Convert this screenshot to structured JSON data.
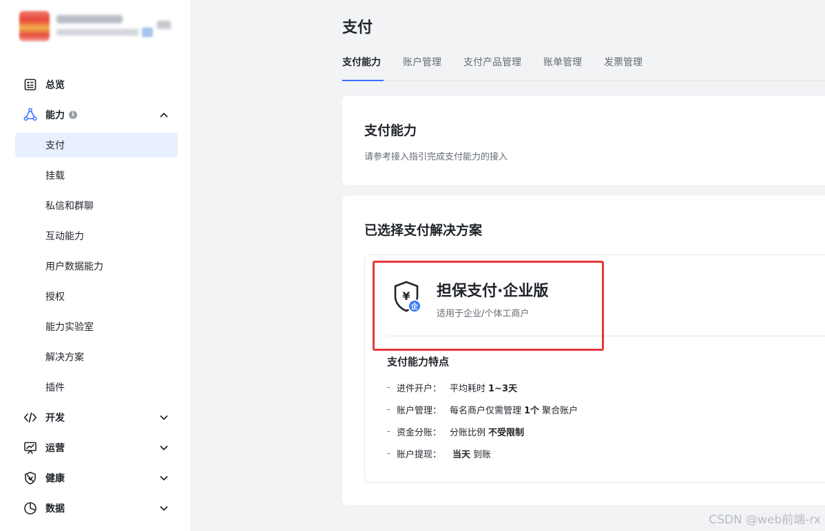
{
  "sidebar": {
    "items": [
      {
        "label": "总览",
        "icon": "dashboard-icon"
      },
      {
        "label": "能力",
        "icon": "capability-icon",
        "info": "i",
        "expanded": true,
        "children": [
          "支付",
          "挂载",
          "私信和群聊",
          "互动能力",
          "用户数据能力",
          "授权",
          "能力实验室",
          "解决方案",
          "插件"
        ],
        "active_child": "支付"
      },
      {
        "label": "开发",
        "icon": "code-icon"
      },
      {
        "label": "运营",
        "icon": "operation-chart-icon"
      },
      {
        "label": "健康",
        "icon": "health-shield-icon"
      },
      {
        "label": "数据",
        "icon": "pie-chart-icon"
      }
    ]
  },
  "main": {
    "title": "支付",
    "tabs": [
      "支付能力",
      "账户管理",
      "支付产品管理",
      "账单管理",
      "发票管理"
    ],
    "active_tab": "支付能力",
    "intro": {
      "heading": "支付能力",
      "desc": "请参考接入指引完成支付能力的接入"
    },
    "solution": {
      "heading": "已选择支付解决方案",
      "name": "担保支付·企业版",
      "subtitle": "适用于企业/个体工商户",
      "icon_badge": "企",
      "features_title": "支付能力特点",
      "features": [
        {
          "key": "进件开户：",
          "pre": "平均耗时",
          "bold": "1~3天",
          "post": ""
        },
        {
          "key": "账户管理：",
          "pre": "每名商户仅需管理",
          "bold": "1个",
          "post": "聚合账户"
        },
        {
          "key": "资金分账：",
          "pre": "分账比例",
          "bold": "不受限制",
          "post": ""
        },
        {
          "key": "账户提现：",
          "pre": "",
          "bold": "当天",
          "post": "到账"
        }
      ]
    }
  },
  "watermark": "CSDN @web前端-rx",
  "colors": {
    "accent": "#3370ff",
    "active_bg": "#e8f0ff",
    "highlight": "#e8353a",
    "badge": "#3c7cf6"
  }
}
